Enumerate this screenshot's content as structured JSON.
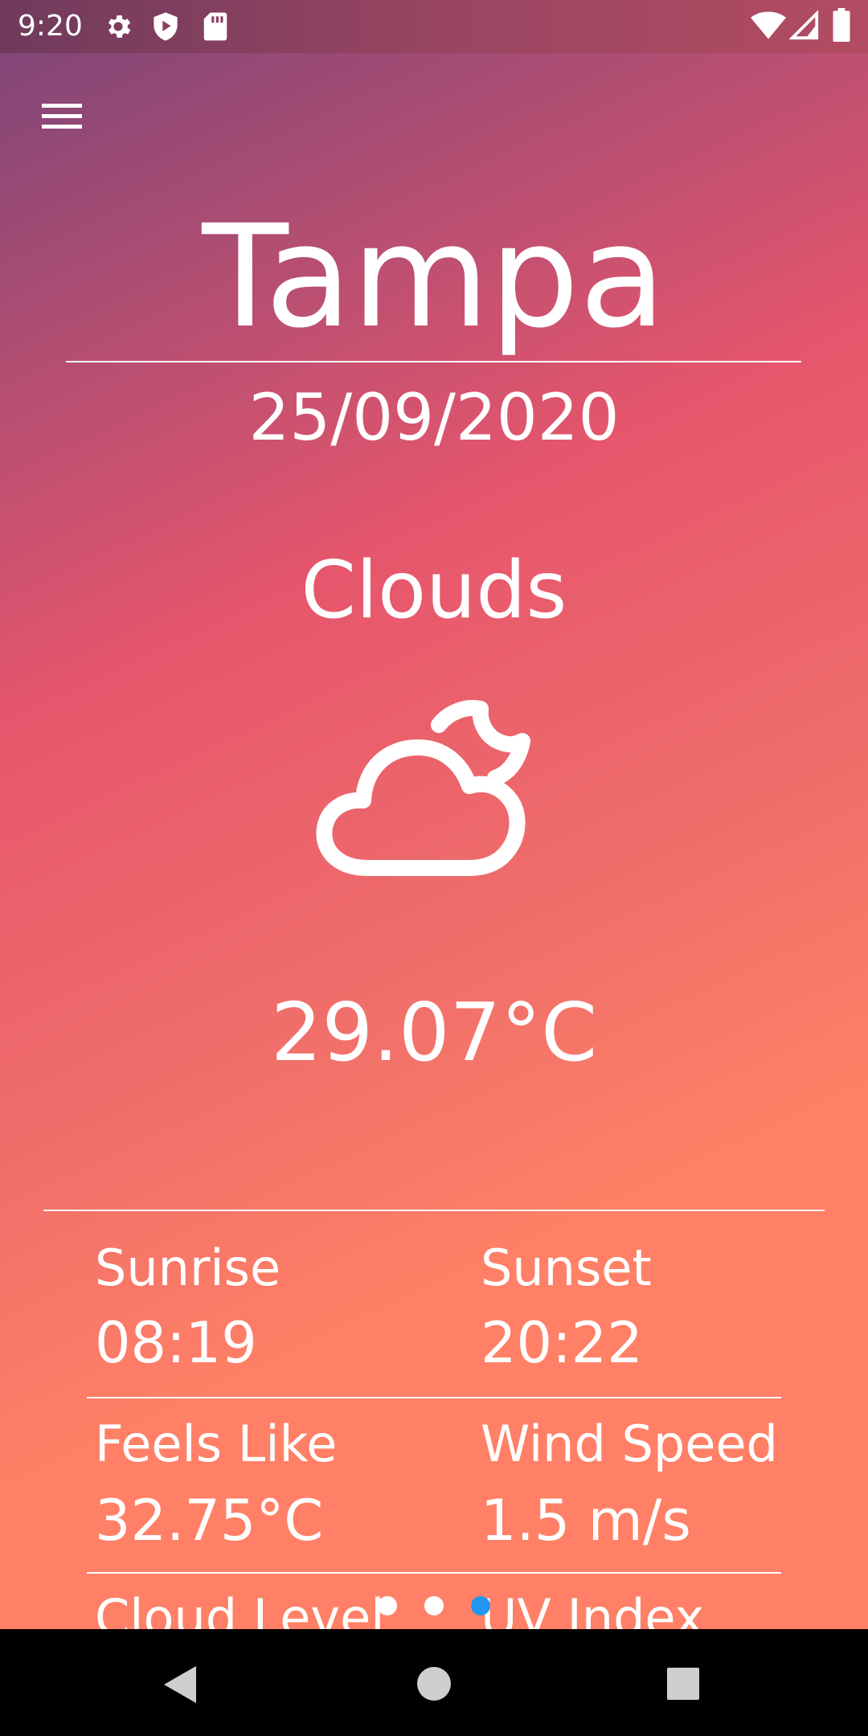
{
  "status_bar": {
    "time": "9:20",
    "icons": [
      "gear-icon",
      "shield-play-icon",
      "sd-card-icon",
      "wifi-icon",
      "signal-icon",
      "battery-icon"
    ]
  },
  "header": {
    "menu_icon": "hamburger-menu-icon"
  },
  "weather": {
    "city": "Tampa",
    "date": "25/09/2020",
    "condition": "Clouds",
    "icon": "cloud-moon-icon",
    "temperature": "29.07°C"
  },
  "details": {
    "sunrise_label": "Sunrise",
    "sunrise_value": "08:19",
    "sunset_label": "Sunset",
    "sunset_value": "20:22",
    "feels_like_label": "Feels Like",
    "feels_like_value": "32.75°C",
    "wind_speed_label": "Wind Speed",
    "wind_speed_value": "1.5 m/s",
    "cloud_level_label": "Cloud Level",
    "uv_index_label": "UV Index"
  },
  "pager": {
    "count": 3,
    "active_index": 2,
    "active_color": "#2196f3",
    "inactive_color": "#ffffff"
  },
  "nav_bar": {
    "buttons": [
      "back-icon",
      "home-icon",
      "recents-icon"
    ]
  },
  "colors": {
    "gradient_top": "#7a4578",
    "gradient_mid": "#e6566c",
    "gradient_bottom": "#ff8066",
    "text": "#ffffff"
  }
}
